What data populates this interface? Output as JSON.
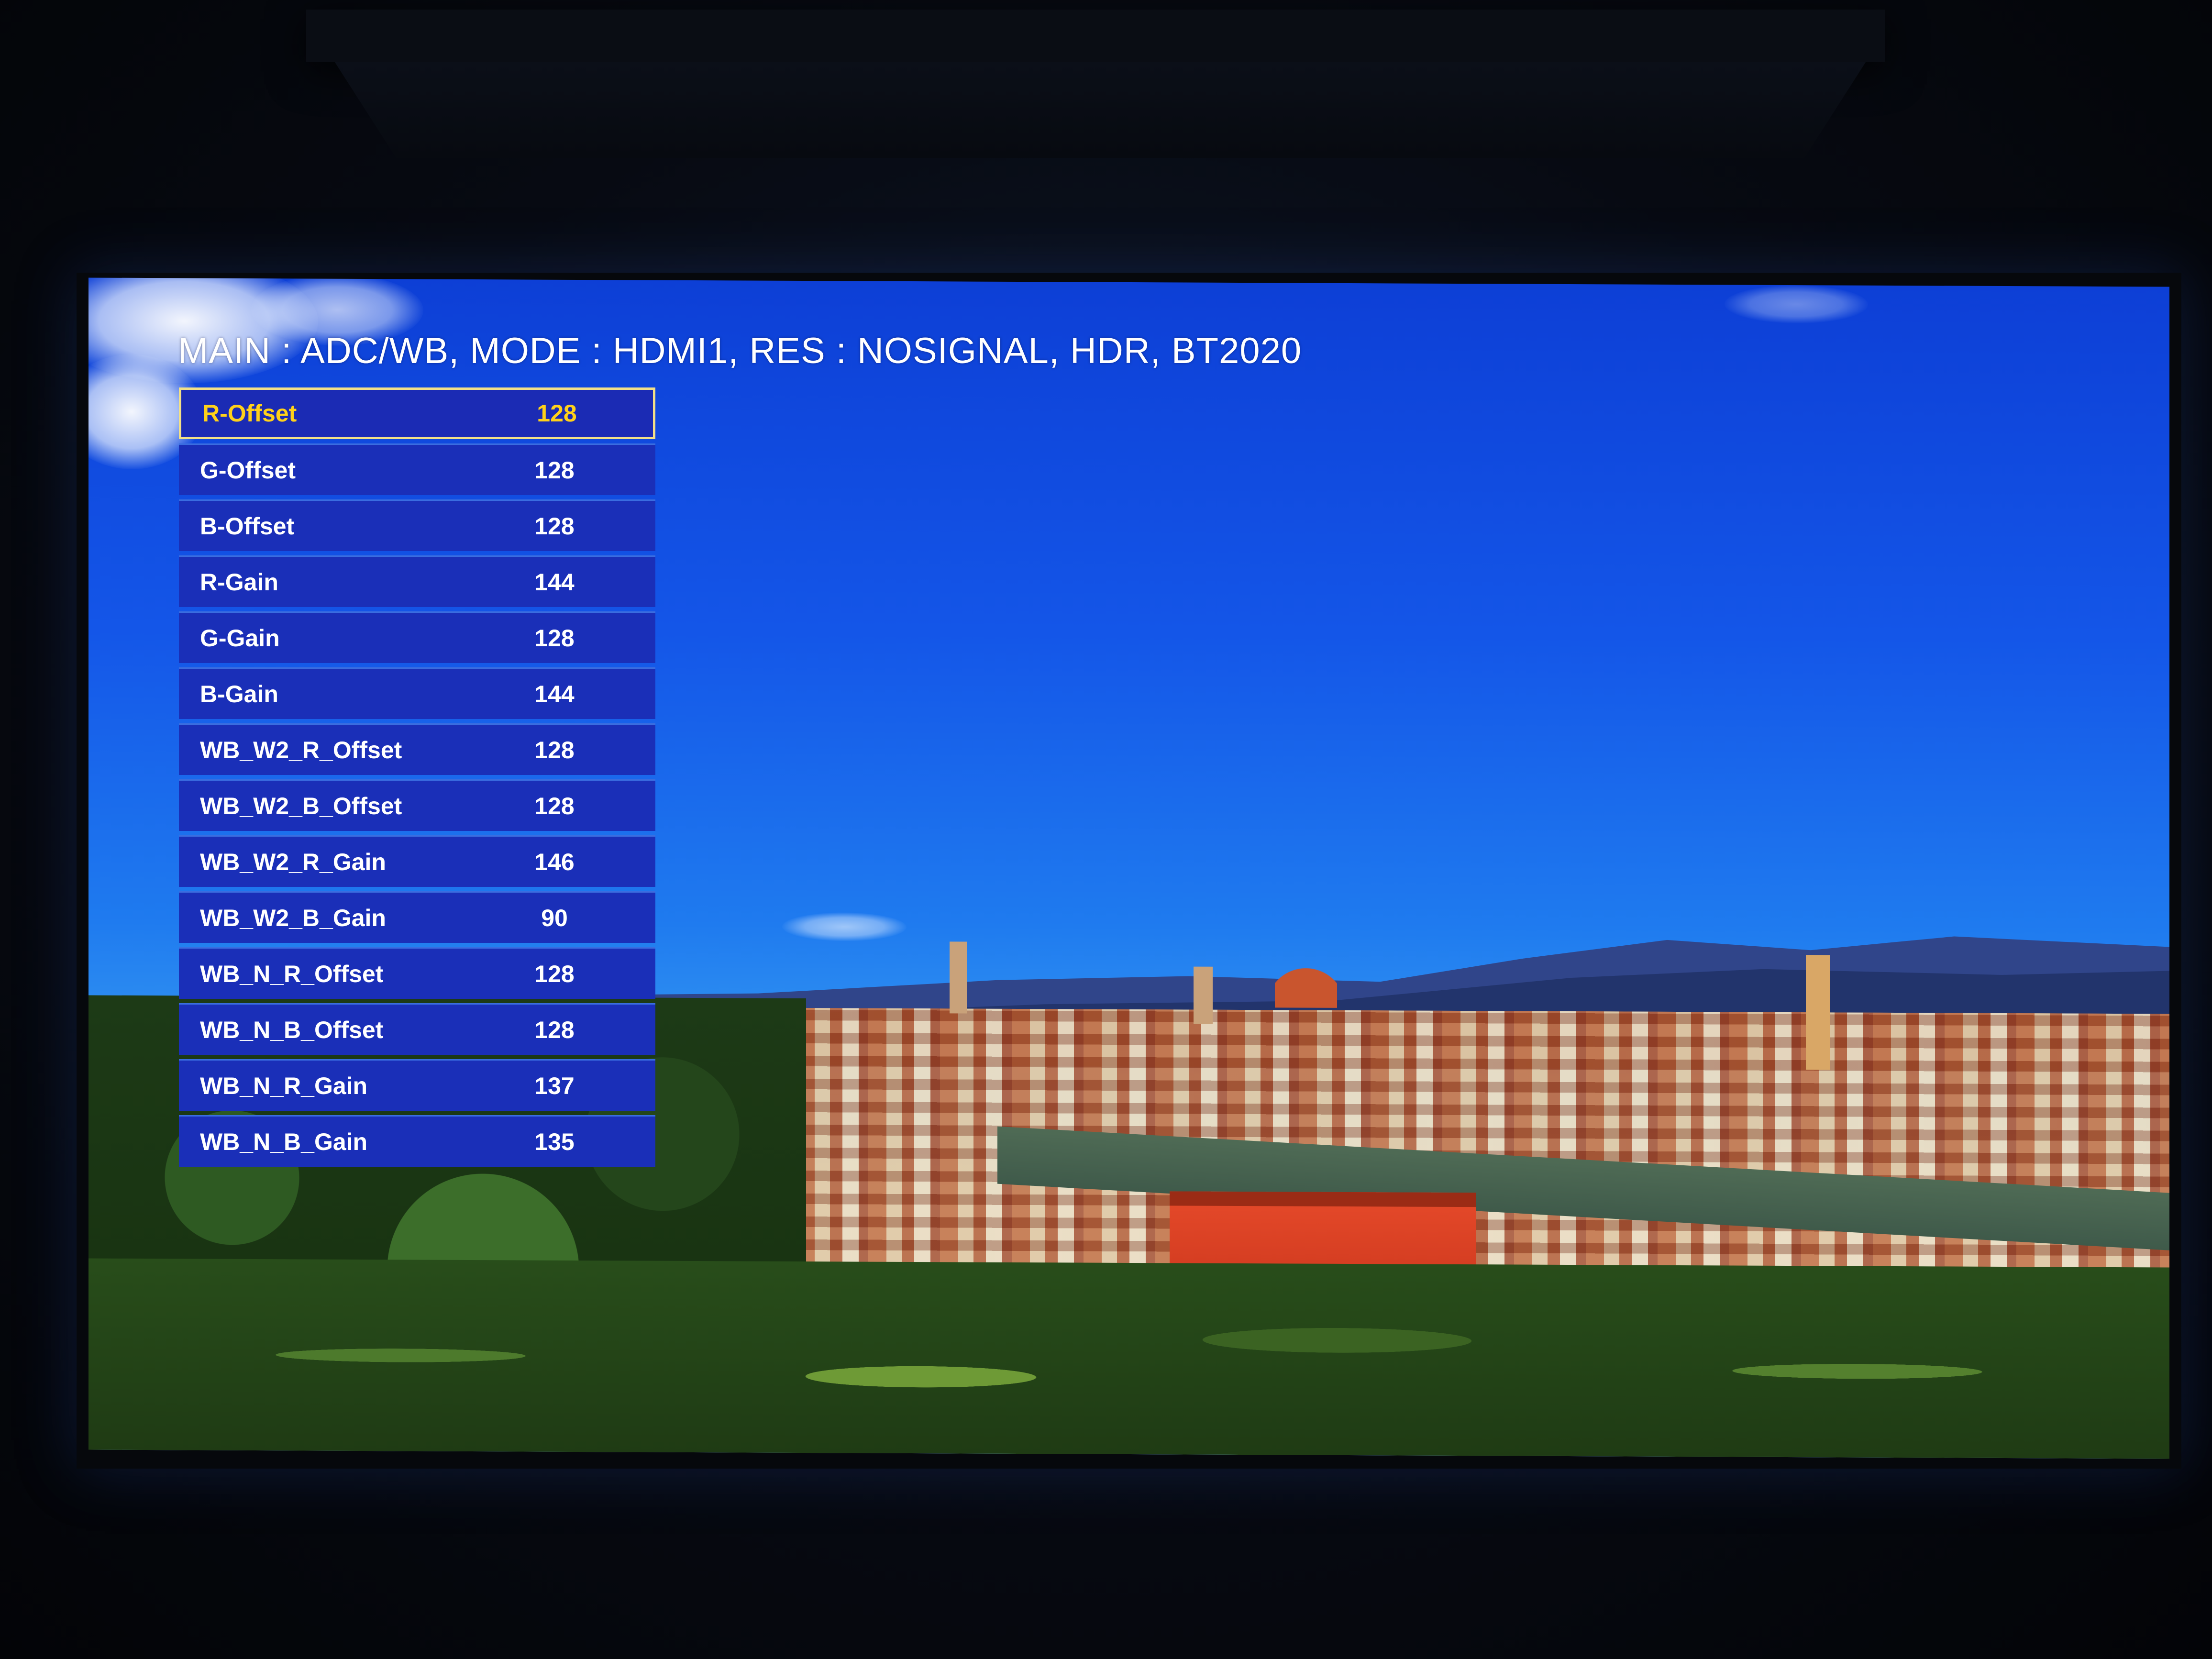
{
  "osd": {
    "title": "MAIN : ADC/WB, MODE : HDMI1, RES : NOSIGNAL, HDR, BT2020",
    "items": [
      {
        "label": "R-Offset",
        "value": "128"
      },
      {
        "label": "G-Offset",
        "value": "128"
      },
      {
        "label": "B-Offset",
        "value": "128"
      },
      {
        "label": "R-Gain",
        "value": "144"
      },
      {
        "label": "G-Gain",
        "value": "128"
      },
      {
        "label": "B-Gain",
        "value": "144"
      },
      {
        "label": "WB_W2_R_Offset",
        "value": "128"
      },
      {
        "label": "WB_W2_B_Offset",
        "value": "128"
      },
      {
        "label": "WB_W2_R_Gain",
        "value": "146"
      },
      {
        "label": "WB_W2_B_Gain",
        "value": "90"
      },
      {
        "label": "WB_N_R_Offset",
        "value": "128"
      },
      {
        "label": "WB_N_B_Offset",
        "value": "128"
      },
      {
        "label": "WB_N_R_Gain",
        "value": "137"
      },
      {
        "label": "WB_N_B_Gain",
        "value": "135"
      }
    ],
    "selected_index": 0
  },
  "colors": {
    "menu_row_bg": "#1a2fb8",
    "selected_border": "#f2e088",
    "selected_text": "#ffd11a"
  }
}
